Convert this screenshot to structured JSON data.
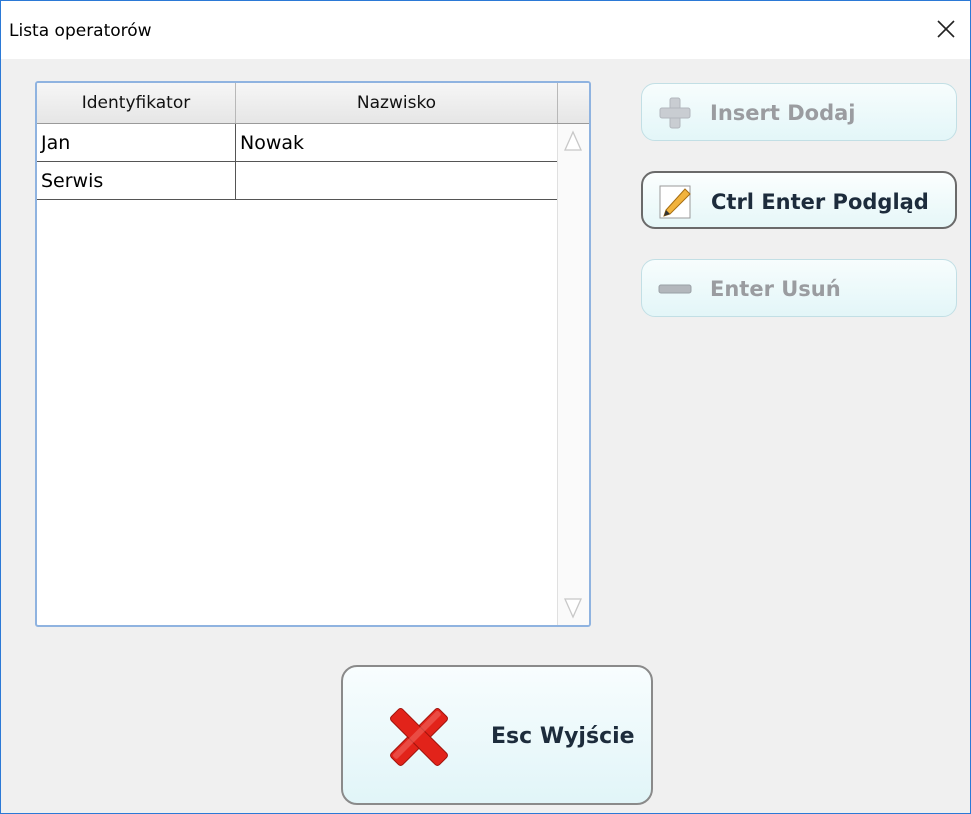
{
  "window": {
    "title": "Lista operatorów"
  },
  "table": {
    "columns": [
      "Identyfikator",
      "Nazwisko"
    ],
    "rows": [
      {
        "identyfikator": "Jan",
        "nazwisko": "Nowak"
      },
      {
        "identyfikator": "Serwis",
        "nazwisko": ""
      }
    ]
  },
  "buttons": {
    "insert": {
      "label": "Insert Dodaj",
      "enabled": false,
      "icon": "plus-icon"
    },
    "preview": {
      "label": "Ctrl Enter Podgląd",
      "enabled": true,
      "icon": "pencil-icon"
    },
    "delete": {
      "label": "Enter Usuń",
      "enabled": false,
      "icon": "minus-icon"
    },
    "exit": {
      "label": "Esc Wyjście",
      "icon": "red-x-icon"
    }
  },
  "colors": {
    "window_border": "#2b79d6",
    "exit_icon": "#e2231a"
  }
}
